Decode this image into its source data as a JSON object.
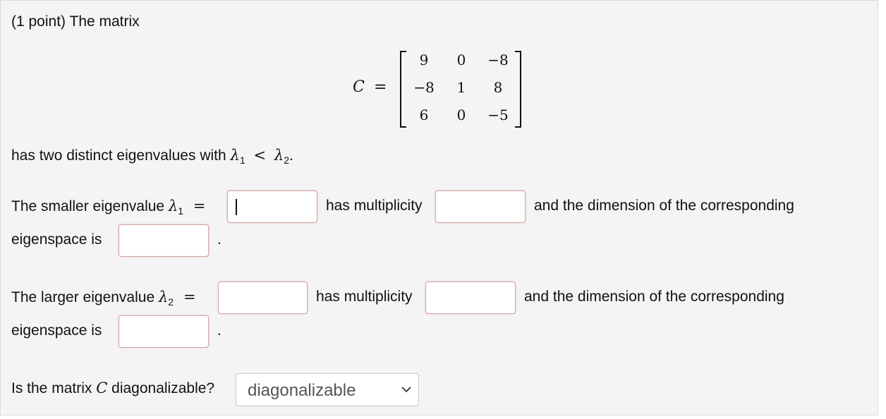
{
  "problem": {
    "intro": "(1 point) The matrix",
    "matrix_label": "C",
    "matrix_equals": "=",
    "matrix": [
      [
        "9",
        "0",
        "−8"
      ],
      [
        "−8",
        "1",
        "8"
      ],
      [
        "6",
        "0",
        "−5"
      ]
    ],
    "distinct_text": "has two distinct eigenvalues with",
    "lambda": "λ",
    "sub1": "1",
    "sub2": "2",
    "less_than": "<",
    "period": "."
  },
  "part1": {
    "prefix": "The smaller eigenvalue",
    "equals": "=",
    "multiplicity_text": "has multiplicity",
    "dimension_text": "and the dimension of the corresponding",
    "eigenspace_text": "eigenspace is",
    "period": "."
  },
  "part2": {
    "prefix": "The larger eigenvalue",
    "equals": "=",
    "multiplicity_text": "has multiplicity",
    "dimension_text": "and the dimension of the corresponding",
    "eigenspace_text": "eigenspace is",
    "period": "."
  },
  "question": {
    "prefix": "Is the matrix",
    "matrix_label": "C",
    "suffix": "diagonalizable?",
    "select_value": "diagonalizable"
  }
}
